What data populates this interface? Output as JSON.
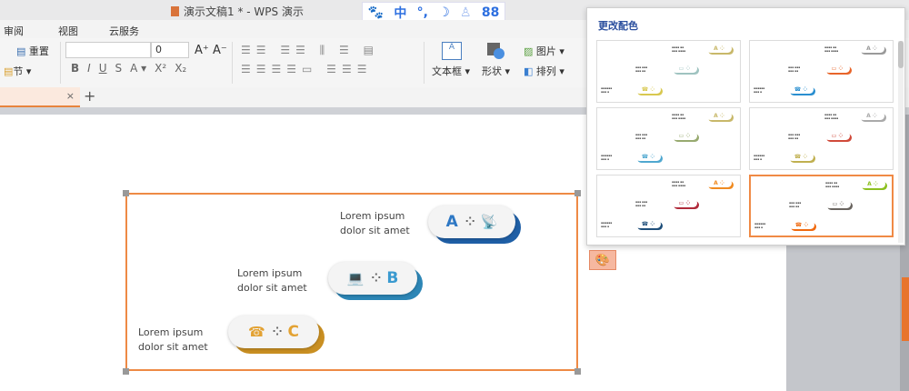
{
  "window": {
    "title": "演示文稿1 * - WPS 演示"
  },
  "ime": {
    "items": [
      "🐾",
      "中",
      "°,",
      "☽",
      "♙",
      "88"
    ]
  },
  "menu": [
    "审阅",
    "视图",
    "云服务"
  ],
  "ribbon": {
    "reset": "重置",
    "section": "节 ▾",
    "font_size": "0",
    "textbox": "文本框 ▾",
    "shape": "形状 ▾",
    "picture": "图片 ▾",
    "arrange": "排列 ▾",
    "font_buttons": [
      "B",
      "I",
      "U",
      "S",
      "A ▾",
      "X²",
      "X₂"
    ],
    "grow": "A⁺",
    "shrink": "A⁻"
  },
  "tab": {
    "close": "×",
    "add": "+"
  },
  "slide": {
    "items": [
      {
        "letter": "A",
        "line1": "Lorem ipsum",
        "line2": "dolor sit amet",
        "color": "#2e78c4",
        "shadow": "#1f5fa6",
        "icon": "satellite-dish-icon",
        "glyph": "📡"
      },
      {
        "letter": "B",
        "line1": "Lorem ipsum",
        "line2": "dolor sit amet",
        "color": "#3a9ad0",
        "shadow": "#2d86b6",
        "icon": "laptop-icon",
        "glyph": "💻"
      },
      {
        "letter": "C",
        "line1": "Lorem ipsum",
        "line2": "dolor sit amet",
        "color": "#e3a233",
        "shadow": "#c98f22",
        "icon": "telephone-icon",
        "glyph": "☎"
      }
    ]
  },
  "popup": {
    "title": "更改配色",
    "schemes": [
      {
        "colors": [
          "#c8b86a",
          "#9fc3c0",
          "#d8c850"
        ],
        "selected": false
      },
      {
        "colors": [
          "#9a9a9a",
          "#e8652a",
          "#2a8fd0"
        ],
        "selected": false
      },
      {
        "colors": [
          "#c8b86a",
          "#98aa70",
          "#50a8d0"
        ],
        "selected": false
      },
      {
        "colors": [
          "#aaaaaa",
          "#d04a3a",
          "#c0b050"
        ],
        "selected": false
      },
      {
        "colors": [
          "#f08a20",
          "#b02a3a",
          "#1f4f7a"
        ],
        "selected": false
      },
      {
        "colors": [
          "#8cc020",
          "#6a6560",
          "#f06a10"
        ],
        "selected": true
      }
    ]
  }
}
